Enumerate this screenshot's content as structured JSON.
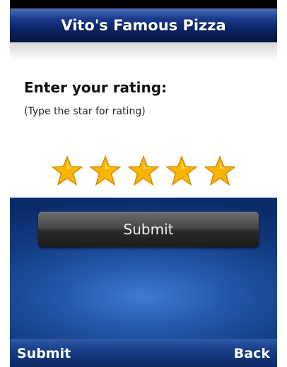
{
  "header": {
    "title": "Vito's Famous Pizza"
  },
  "rating": {
    "prompt": "Enter your rating:",
    "hint": "(Type the star for rating)",
    "value": 5,
    "max": 5,
    "star_color": "#f7b500"
  },
  "main": {
    "submit_label": "Submit"
  },
  "softkeys": {
    "left": "Submit",
    "right": "Back"
  },
  "colors": {
    "title_bar": "#0c2466",
    "panel_blue": "#2355a8",
    "button_dark": "#2a2a2a"
  }
}
